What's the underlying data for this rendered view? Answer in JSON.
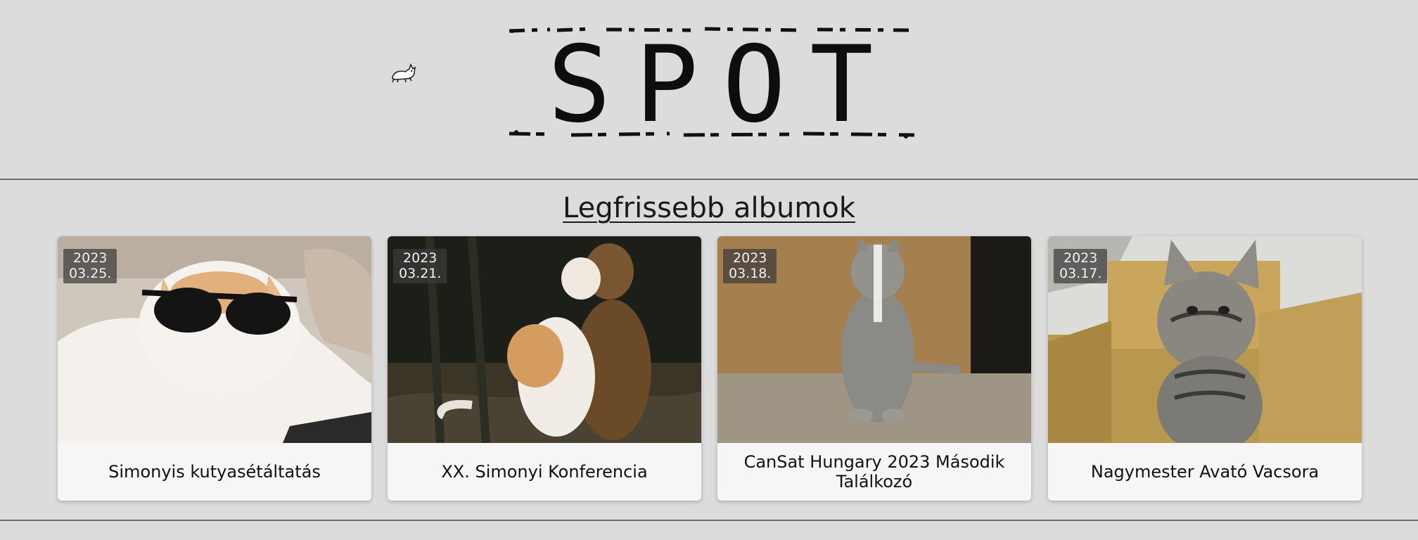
{
  "header": {
    "logo_text": "SPOT",
    "mascot_icon": "cat-icon"
  },
  "section": {
    "title": "Legfrissebb albumok"
  },
  "albums": [
    {
      "date_year": "2023",
      "date_day": "03.25.",
      "title": "Simonyis kutyasétáltatás",
      "image": "cat-sunglasses-photo"
    },
    {
      "date_year": "2023",
      "date_day": "03.21.",
      "title": "XX. Simonyi Konferencia",
      "image": "cat-hugging-dog-photo"
    },
    {
      "date_year": "2023",
      "date_day": "03.18.",
      "title": "CanSat Hungary 2023 Második Találkozó",
      "image": "cat-standing-photo"
    },
    {
      "date_year": "2023",
      "date_day": "03.17.",
      "title": "Nagymester Avató Vacsora",
      "image": "cat-in-box-photo"
    }
  ]
}
